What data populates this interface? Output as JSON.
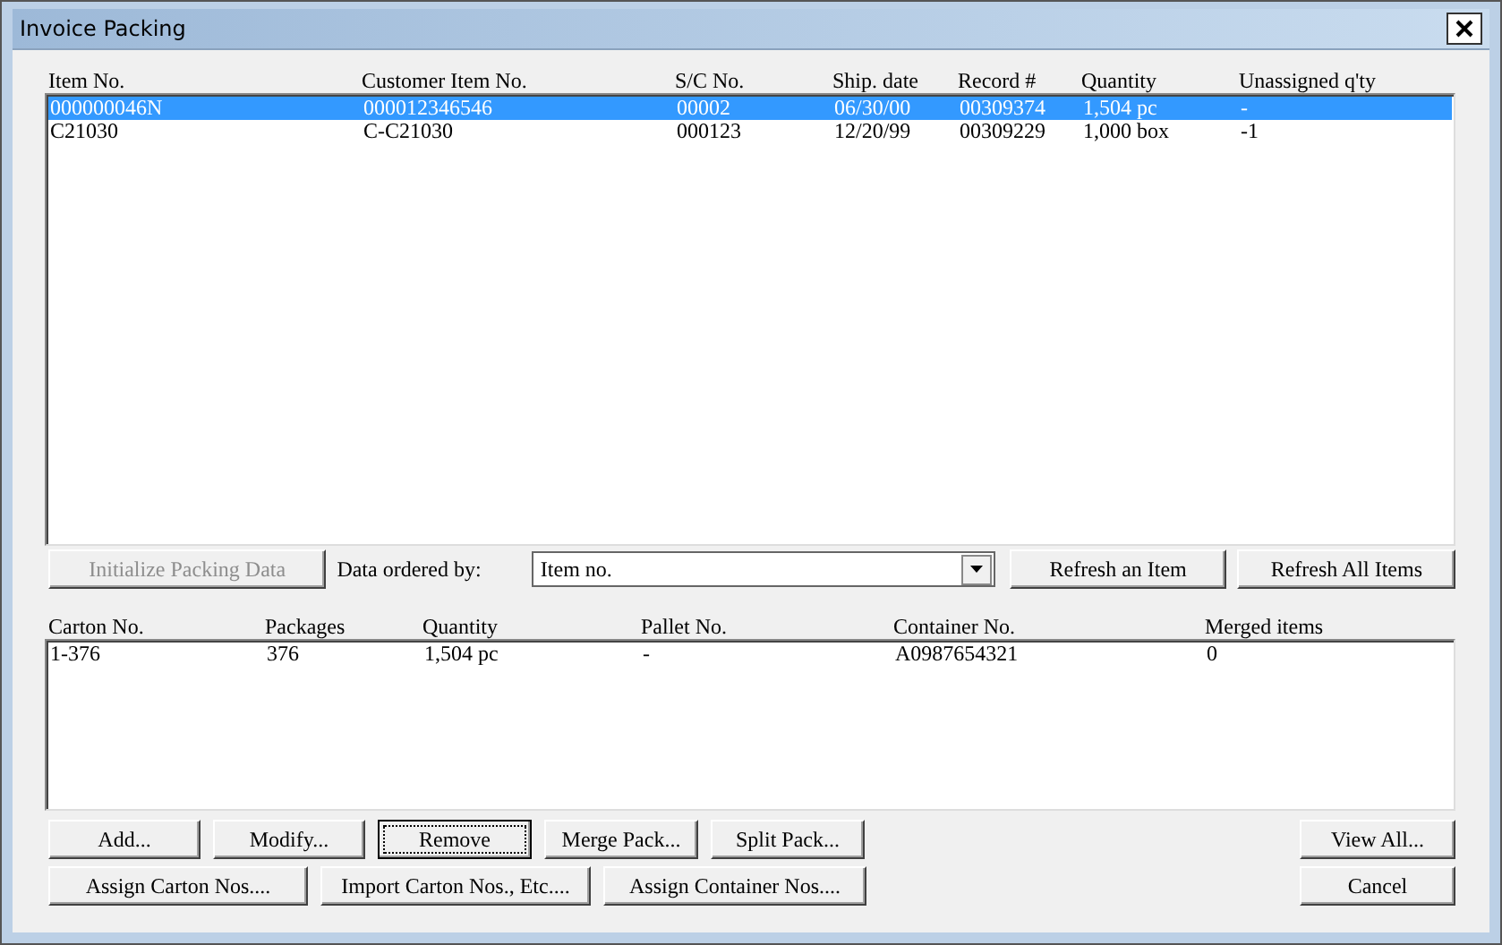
{
  "window": {
    "title": "Invoice Packing"
  },
  "items_table": {
    "columns": [
      "Item No.",
      "Customer Item No.",
      "S/C No.",
      "Ship. date",
      "Record #",
      "Quantity",
      "Unassigned q'ty"
    ],
    "rows": [
      {
        "selected": true,
        "cells": [
          "000000046N",
          "000012346546",
          "00002",
          "06/30/00",
          "00309374",
          "1,504 pc",
          "-"
        ]
      },
      {
        "selected": false,
        "cells": [
          "C21030",
          "C-C21030",
          "000123",
          "12/20/99",
          "00309229",
          "1,000 box",
          "-1"
        ]
      }
    ]
  },
  "initialize_button": {
    "label": "Initialize Packing Data",
    "disabled": true
  },
  "order_label": "Data ordered by:",
  "order_select": {
    "value": "Item no."
  },
  "refresh_buttons": [
    {
      "label": "Refresh an Item",
      "disabled": false
    },
    {
      "label": "Refresh All Items",
      "disabled": false
    }
  ],
  "cartons_table": {
    "columns": [
      "Carton No.",
      "Packages",
      "Quantity",
      "Pallet No.",
      "Container No.",
      "Merged items"
    ],
    "rows": [
      {
        "selected": false,
        "cells": [
          "1-376",
          "376",
          "1,504 pc",
          "-",
          "A0987654321",
          "0"
        ]
      }
    ]
  },
  "buttons_row1": [
    {
      "label": "Add...",
      "focused": false
    },
    {
      "label": "Modify...",
      "focused": false
    },
    {
      "label": "Remove",
      "focused": true
    },
    {
      "label": "Merge Pack...",
      "focused": false
    },
    {
      "label": "Split Pack...",
      "focused": false
    }
  ],
  "buttons_row2": [
    {
      "label": "Assign Carton Nos....",
      "focused": false
    },
    {
      "label": "Import Carton Nos., Etc....",
      "focused": false
    },
    {
      "label": "Assign Container Nos....",
      "focused": false
    }
  ],
  "side_buttons": [
    {
      "label": "View All..."
    },
    {
      "label": "Cancel"
    }
  ]
}
